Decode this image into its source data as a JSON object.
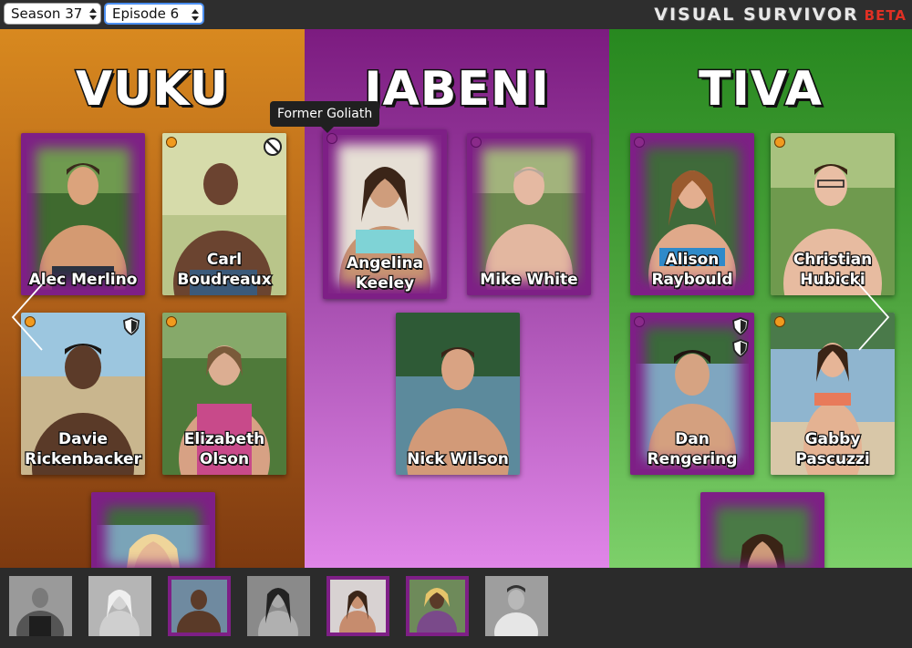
{
  "controls": {
    "season_selected": "Season 37",
    "episode_selected": "Episode 6"
  },
  "brand": {
    "name": "VISUAL SURVIVOR",
    "beta": "BETA"
  },
  "tooltip": "Former Goliath",
  "colors": {
    "vuku": "#c87a1c",
    "jabeni": "#8b2a91",
    "tiva": "#3f9a32",
    "former_goliath_dot": "#f19a1e",
    "former_david_border": "#7e1f86"
  },
  "tribes": [
    {
      "name": "VUKU",
      "castaways": [
        "Alec Merlino",
        "Carl\nBoudreaux",
        "Davie\nRickenbacker",
        "Elizabeth\nOlson",
        ""
      ]
    },
    {
      "name": "JABENI",
      "castaways": [
        "Angelina\nKeeley",
        "Mike White",
        "Nick Wilson"
      ]
    },
    {
      "name": "TIVA",
      "castaways": [
        "Alison\nRaybould",
        "Christian\nHubicki",
        "Dan\nRengering",
        "Gabby\nPascuzzi",
        ""
      ]
    }
  ],
  "icons": {
    "carl": "ban-icon",
    "davie": "shield-icon",
    "dan": [
      "shield-icon",
      "shield-icon"
    ]
  },
  "eliminated_count": 7
}
